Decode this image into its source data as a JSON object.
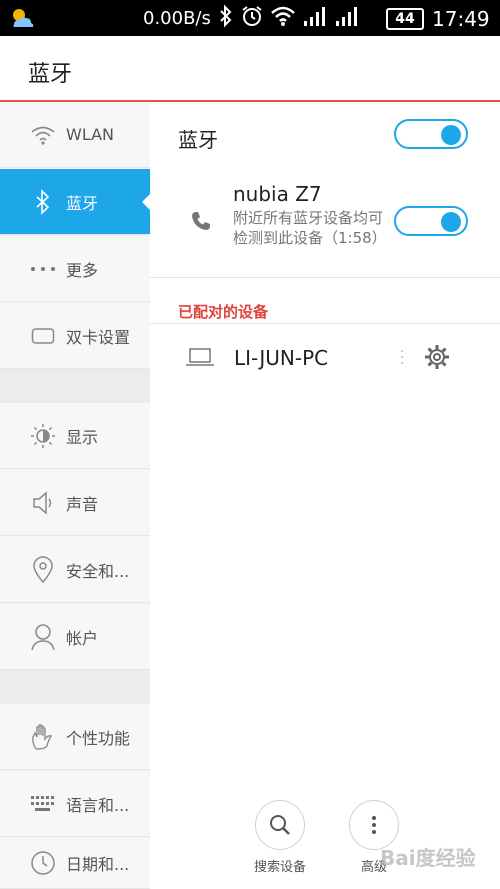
{
  "status_bar": {
    "net_speed": "0.00B/s",
    "battery": "44",
    "time": "17:49",
    "icons": [
      "weather-icon",
      "bluetooth-icon",
      "alarm-icon",
      "wifi-icon",
      "signal-icon",
      "signal-icon-2",
      "battery-icon"
    ]
  },
  "app_bar": {
    "title": "蓝牙"
  },
  "sidebar": {
    "items": [
      {
        "label": "WLAN",
        "icon": "wifi-icon"
      },
      {
        "label": "蓝牙",
        "icon": "bluetooth-icon",
        "active": true
      },
      {
        "label": "更多",
        "icon": "more-dots-icon"
      },
      {
        "label": "双卡设置",
        "icon": "sim-card-icon"
      },
      {
        "label": "显示",
        "icon": "brightness-icon"
      },
      {
        "label": "声音",
        "icon": "speaker-icon"
      },
      {
        "label": "安全和...",
        "icon": "location-pin-icon"
      },
      {
        "label": "帐户",
        "icon": "person-icon"
      },
      {
        "label": "个性功能",
        "icon": "hand-icon"
      },
      {
        "label": "语言和...",
        "icon": "keyboard-icon"
      },
      {
        "label": "日期和...",
        "icon": "clock-icon"
      }
    ]
  },
  "main": {
    "bluetooth_label": "蓝牙",
    "bluetooth_enabled": true,
    "device": {
      "name": "nubia Z7",
      "description": "附近所有蓝牙设备均可检测到此设备（1:58）",
      "visible": true
    },
    "paired_section_title": "已配对的设备",
    "paired_devices": [
      {
        "name": "LI-JUN-PC",
        "icon": "laptop-icon"
      }
    ],
    "actions": [
      {
        "label": "搜索设备",
        "icon": "search-icon"
      },
      {
        "label": "高级",
        "icon": "more-vertical-icon"
      }
    ]
  },
  "watermark": "Bai度经验",
  "colors": {
    "accent": "#1ea7e8",
    "header_divider": "#e8504a",
    "section_red": "#e3423d"
  }
}
